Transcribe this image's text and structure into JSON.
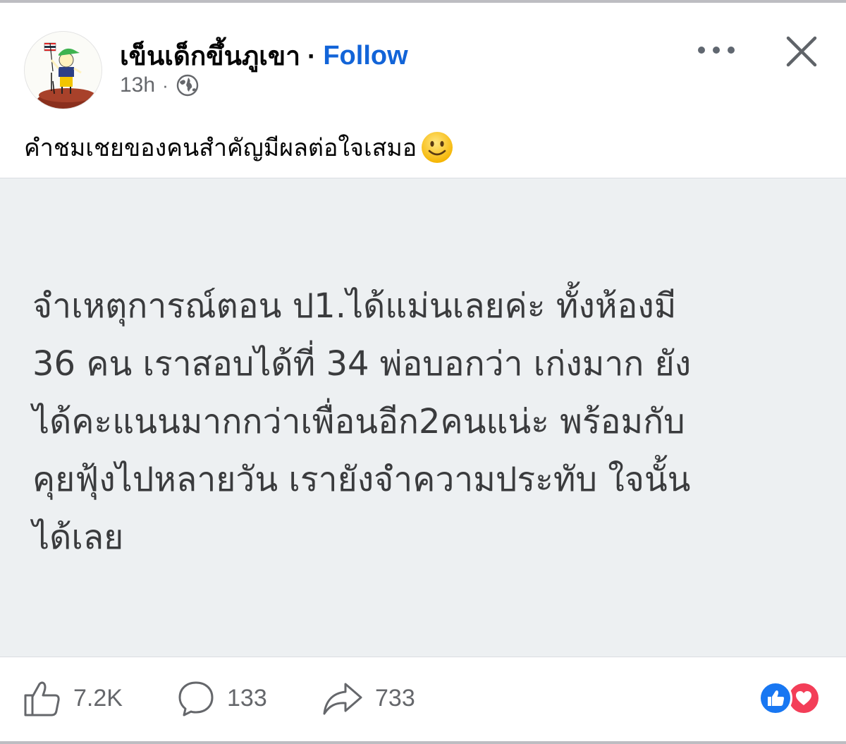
{
  "post": {
    "author": "เข็นเด็กขึ้นภูเขา",
    "separator": "·",
    "follow_label": "Follow",
    "timestamp": "13h",
    "meta_separator": "·",
    "audience_icon": "globe-icon",
    "caption": "คำชมเชยของคนสำคัญมีผลต่อใจเสมอ",
    "caption_emoji": "slightly-smiling-face-icon",
    "image_text": "จำเหตุการณ์ตอน ป1.ได้แม่นเลยค่ะ ทั้งห้องมี\n36 คน เราสอบได้ที่ 34 พ่อบอกว่า เก่งมาก ยัง\nได้คะแนนมากกว่าเพื่อนอีก2คนแน่ะ พร้อมกับ\nคุยฟุ้งไปหลายวัน เรายังจำความประทับ ใจนั้น\nได้เลย"
  },
  "actions": {
    "like_count": "7.2K",
    "comment_count": "133",
    "share_count": "733"
  },
  "reactions": [
    "like-reaction-icon",
    "love-reaction-icon"
  ],
  "colors": {
    "follow": "#1264d8",
    "like_reaction": "#1877f2",
    "love_reaction": "#f33e58",
    "muted_text": "#65676b",
    "image_background": "#edf0f2"
  }
}
